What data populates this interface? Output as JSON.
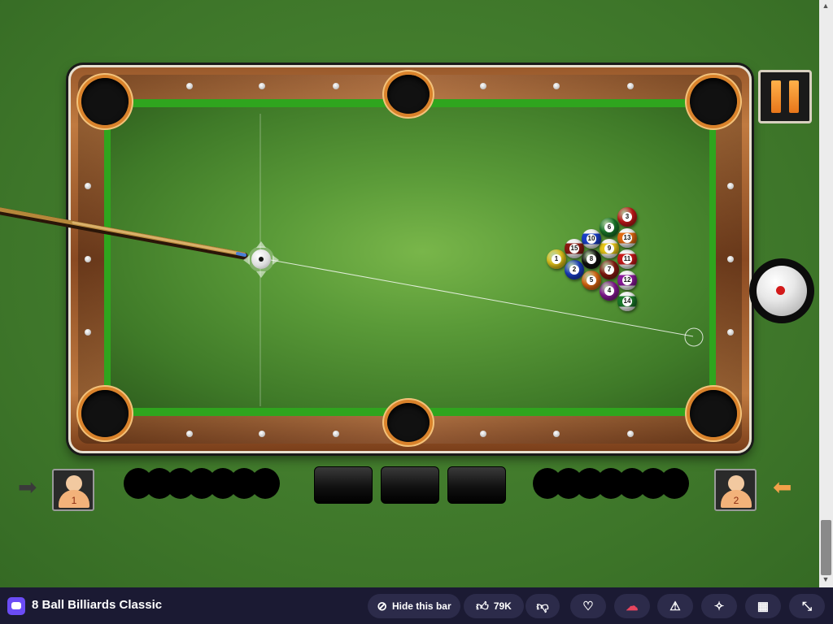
{
  "game": {
    "balls": [
      {
        "n": "1",
        "color": "#e8c81a",
        "stripe": false
      },
      {
        "n": "2",
        "color": "#1a3fc7",
        "stripe": false
      },
      {
        "n": "3",
        "color": "#c81a1a",
        "stripe": false
      },
      {
        "n": "4",
        "color": "#8a1a9a",
        "stripe": false
      },
      {
        "n": "5",
        "color": "#e06a12",
        "stripe": false
      },
      {
        "n": "6",
        "color": "#1a7a2a",
        "stripe": false
      },
      {
        "n": "7",
        "color": "#8a1a12",
        "stripe": false
      },
      {
        "n": "8",
        "color": "#111111",
        "stripe": false
      },
      {
        "n": "9",
        "color": "#e8c81a",
        "stripe": true
      },
      {
        "n": "10",
        "color": "#1a3fc7",
        "stripe": true
      },
      {
        "n": "11",
        "color": "#c81a1a",
        "stripe": true
      },
      {
        "n": "12",
        "color": "#8a1a9a",
        "stripe": true
      },
      {
        "n": "13",
        "color": "#e06a12",
        "stripe": true
      },
      {
        "n": "14",
        "color": "#1a7a2a",
        "stripe": true
      },
      {
        "n": "15",
        "color": "#8a1a12",
        "stripe": true
      }
    ],
    "player1": {
      "label": "1"
    },
    "player2": {
      "label": "2"
    },
    "icons": {
      "pause": "pause-icon",
      "spin": "cue-spin-icon",
      "turn_left": "arrow-left-icon",
      "turn_right": "arrow-right-icon"
    }
  },
  "bottom_bar": {
    "title": "8 Ball Billiards Classic",
    "hide_bar_label": "Hide this bar",
    "likes": "79K",
    "icons": [
      "hide-icon",
      "thumbs-up-icon",
      "thumbs-down-icon",
      "heart-icon",
      "cloud-icon",
      "report-icon",
      "puzzle-icon",
      "qr-icon",
      "fullscreen-icon"
    ]
  }
}
